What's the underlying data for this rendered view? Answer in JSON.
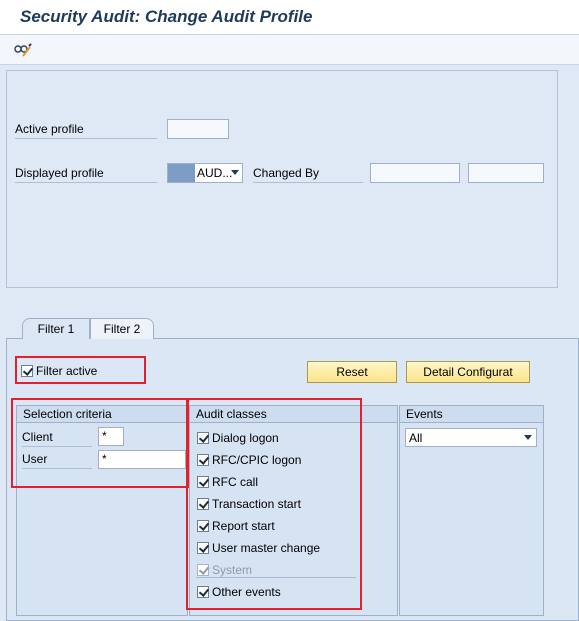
{
  "window": {
    "title": "Security Audit: Change Audit Profile"
  },
  "toolbar": {
    "icons": [
      "glasses-pencil-icon"
    ]
  },
  "header": {
    "active_profile_label": "Active profile",
    "active_profile_value": "",
    "displayed_profile_label": "Displayed profile",
    "displayed_profile_value": "AUD...",
    "changed_by_label": "Changed By",
    "changed_by_value": "",
    "changed_on_value": ""
  },
  "tabs": [
    {
      "label": "Filter 1",
      "active": true
    },
    {
      "label": "Filter 2",
      "active": false
    }
  ],
  "filter": {
    "filter_active_label": "Filter active",
    "filter_active_checked": true,
    "reset_label": "Reset",
    "detail_label": "Detail Configurat"
  },
  "selection_criteria": {
    "title": "Selection criteria",
    "client_label": "Client",
    "client_value": "*",
    "user_label": "User",
    "user_value": "*"
  },
  "audit_classes": {
    "title": "Audit classes",
    "items": [
      {
        "label": "Dialog logon",
        "checked": true,
        "disabled": false
      },
      {
        "label": "RFC/CPIC logon",
        "checked": true,
        "disabled": false
      },
      {
        "label": "RFC call",
        "checked": true,
        "disabled": false
      },
      {
        "label": "Transaction start",
        "checked": true,
        "disabled": false
      },
      {
        "label": "Report start",
        "checked": true,
        "disabled": false
      },
      {
        "label": "User master change",
        "checked": true,
        "disabled": false
      },
      {
        "label": "System",
        "checked": true,
        "disabled": true
      },
      {
        "label": "Other events",
        "checked": true,
        "disabled": false
      }
    ]
  },
  "events": {
    "title": "Events",
    "selected": "All"
  },
  "colors": {
    "highlight_red": "#e4202e",
    "button_yellow": "#fbe58a",
    "panel_blue": "#dfe9f5"
  }
}
